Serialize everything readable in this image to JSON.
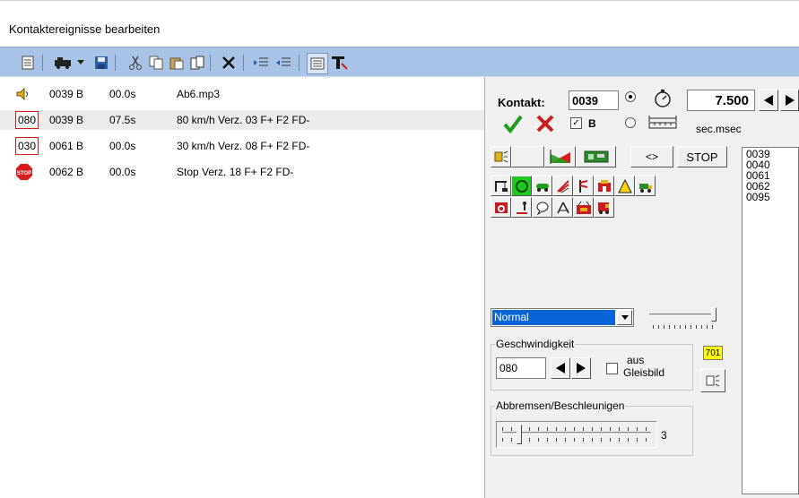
{
  "window": {
    "title": "Kontaktereignisse bearbeiten"
  },
  "toolbar": {
    "buttons": [
      "document-icon",
      "loco-icon",
      "dropdown-arrow-icon",
      "save-icon",
      "cut-icon",
      "copy-icon",
      "paste-icon",
      "paste-special-icon",
      "delete-icon",
      "indent-icon",
      "outdent-icon",
      "list-view-icon",
      "tool-t-icon"
    ]
  },
  "events": [
    {
      "icon": "speaker-icon",
      "contact": "0039 B",
      "time": "00.0s",
      "text": "Ab6.mp3",
      "badge": ""
    },
    {
      "icon": "speed-badge",
      "contact": "0039 B",
      "time": "07.5s",
      "text": "80 km/h Verz. 03 F+ F2  FD-",
      "badge": "080"
    },
    {
      "icon": "speed-badge",
      "contact": "0061 B",
      "time": "00.0s",
      "text": "30 km/h Verz. 08 F+ F2  FD-",
      "badge": "030"
    },
    {
      "icon": "stop-icon",
      "contact": "0062 B",
      "time": "00.0s",
      "text": "Stop Verz. 18 F+ F2  FD-",
      "badge": "STOP"
    }
  ],
  "panel": {
    "contact_label": "Kontakt:",
    "contact_value": "0039",
    "time_value": "7.500",
    "b_label": "B",
    "unit_label": "sec.msec",
    "stop_label": "STOP",
    "nav_label": "<>",
    "contact_list": [
      "0039",
      "0040",
      "0061",
      "0062",
      "0095"
    ],
    "mode_value": "Normal",
    "speed_group_label": "Geschwindigkeit",
    "speed_value": "080",
    "from_track_label_1": "aus",
    "from_track_label_2": "Gleisbild",
    "yellow_badge": "701",
    "brake_group_label": "Abbremsen/Beschleunigen",
    "brake_value": "3"
  },
  "colors": {
    "toolbar_bg": "#a9c3e6",
    "selection": "#0a64d8",
    "badge_border": "#d81b1b",
    "ok_green": "#1e9c1e",
    "cancel_red": "#c81e1e",
    "yellow": "#ffff00"
  }
}
